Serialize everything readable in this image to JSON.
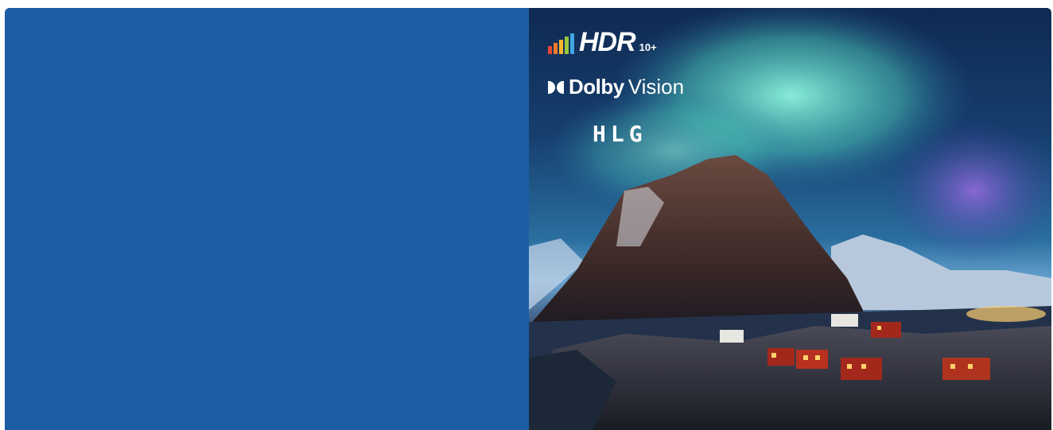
{
  "badges": {
    "hdr_text": "HDR",
    "hdr_superscript": "10+",
    "dolby_word": "Dolby",
    "dolby_vision": "Vision",
    "hlg": "HLG"
  },
  "colors": {
    "left_panel": "#1b5ea5",
    "aurora_green": "#5de8c8",
    "aurora_purple": "#7a55c8",
    "house_red": "#a3281c"
  },
  "hero_image": {
    "scene": "aurora over mountain and fishing village"
  }
}
